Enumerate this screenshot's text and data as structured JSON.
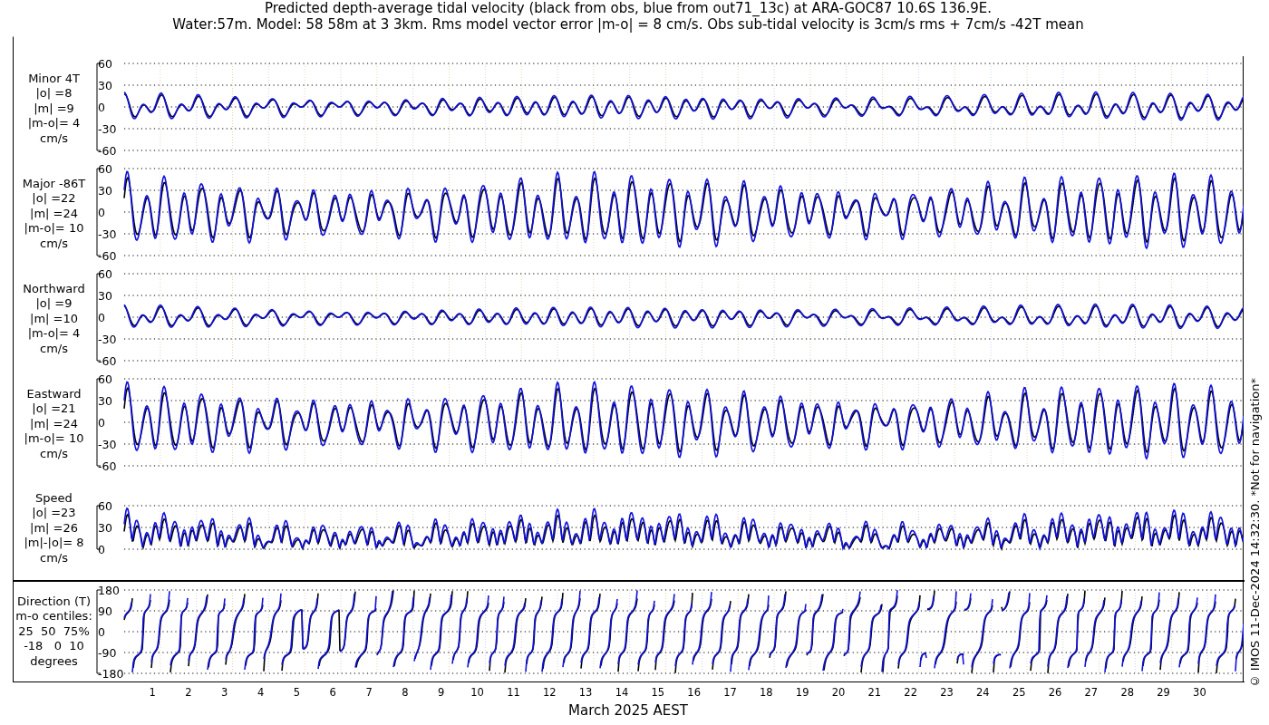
{
  "title_lines": [
    "Predicted depth-average tidal velocity (black from obs, blue from out71_13c) at ARA-GOC87 10.6S 136.9E.",
    "Water:57m. Model: 58 58m at 3 3km. Rms model vector error |m-o| = 8 cm/s. Obs sub-tidal velocity is 3cm/s rms + 7cm/s -42T mean"
  ],
  "panels": [
    {
      "kind": "minor",
      "label_lines": [
        "Minor 4T",
        "|o| =8",
        "|m| =9",
        "|m-o|= 4",
        "cm/s"
      ],
      "yticks": [
        "60",
        "30",
        "0",
        "-30",
        "-60"
      ]
    },
    {
      "kind": "major",
      "label_lines": [
        "Major -86T",
        "|o| =22",
        "|m| =24",
        "|m-o|= 10",
        "cm/s"
      ],
      "yticks": [
        "60",
        "30",
        "0",
        "-30",
        "-60"
      ]
    },
    {
      "kind": "north",
      "label_lines": [
        "Northward",
        "|o| =9",
        "|m| =10",
        "|m-o|= 4",
        "cm/s"
      ],
      "yticks": [
        "60",
        "30",
        "0",
        "-30",
        "-60"
      ]
    },
    {
      "kind": "east",
      "label_lines": [
        "Eastward",
        "|o| =21",
        "|m| =24",
        "|m-o|= 10",
        "cm/s"
      ],
      "yticks": [
        "60",
        "30",
        "0",
        "-30",
        "-60"
      ]
    },
    {
      "kind": "speed",
      "label_lines": [
        "Speed",
        "|o| =23",
        "|m| =26",
        "|m|-|o|= 8",
        "cm/s"
      ],
      "yticks": [
        "60",
        "30",
        "0"
      ]
    }
  ],
  "direction_panel": {
    "kind": "direction",
    "label_lines": [
      "Direction (T)",
      "m-o centiles:",
      "25  50  75%",
      "-18   0  10",
      "degrees"
    ],
    "yticks": [
      "180",
      "90",
      "0",
      "-90",
      "-180"
    ]
  },
  "xticks": [
    "1",
    "2",
    "3",
    "4",
    "5",
    "6",
    "7",
    "8",
    "9",
    "10",
    "11",
    "12",
    "13",
    "14",
    "15",
    "16",
    "17",
    "18",
    "19",
    "20",
    "21",
    "22",
    "23",
    "24",
    "25",
    "26",
    "27",
    "28",
    "29",
    "30"
  ],
  "xlabel": "March 2025 AEST",
  "credit": "© IMOS 11-Dec-2024 14:32:30. *Not for navigation*"
}
